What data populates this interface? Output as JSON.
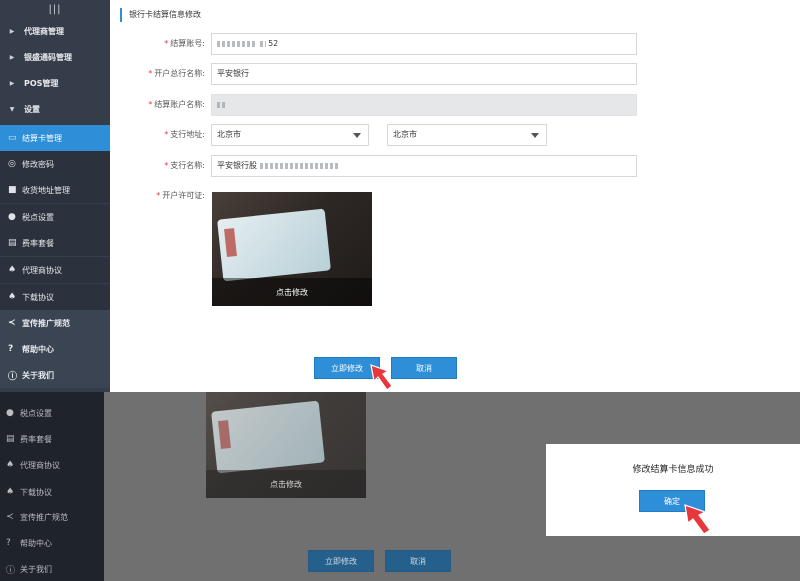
{
  "sidebar": {
    "menu_icon": "hamburger-icon",
    "groups": [
      {
        "label": "代理商管理"
      },
      {
        "label": "银盛通码管理"
      },
      {
        "label": "POS管理"
      },
      {
        "label": "设置"
      }
    ],
    "items": [
      {
        "label": "结算卡管理",
        "icon": "card-icon"
      },
      {
        "label": "修改密码",
        "icon": "key-icon"
      },
      {
        "label": "收货地址管理",
        "icon": "truck-icon"
      },
      {
        "label": "税点设置",
        "icon": "tax-icon"
      },
      {
        "label": "费率套餐",
        "icon": "fee-icon"
      },
      {
        "label": "代理商协议",
        "icon": "bell-icon"
      },
      {
        "label": "下载协议",
        "icon": "download-icon"
      },
      {
        "label": "宣传推广规范",
        "icon": "share-icon"
      },
      {
        "label": "帮助中心",
        "icon": "help-icon"
      },
      {
        "label": "关于我们",
        "icon": "info-icon"
      }
    ]
  },
  "form": {
    "title": "银行卡结算信息修改",
    "account_number_label": "结算账号:",
    "account_number_value_suffix": "52",
    "bank_name_label": "开户总行名称:",
    "bank_name_value": "平安银行",
    "account_holder_label": "结算账户名称:",
    "account_holder_value": "",
    "branch_address_label": "支行地址:",
    "province_value": "北京市",
    "city_value": "北京市",
    "branch_name_label": "支行名称:",
    "branch_name_value": "平安银行股",
    "license_label": "开户许可证:",
    "photo_overlay": "点击修改",
    "submit_label": "立即修改",
    "cancel_label": "取消"
  },
  "modal": {
    "message": "修改结算卡信息成功",
    "ok_label": "确定"
  },
  "bottom_sidebar": {
    "items": [
      {
        "label": "税点设置"
      },
      {
        "label": "费率套餐"
      },
      {
        "label": "代理商协议"
      },
      {
        "label": "下载协议"
      },
      {
        "label": "宣传推广规范"
      },
      {
        "label": "帮助中心"
      },
      {
        "label": "关于我们"
      }
    ]
  },
  "colors": {
    "accent": "#2e8fd8",
    "sidebar": "#353d4b",
    "required": "#e23b3b",
    "arrow": "#e8363a"
  }
}
